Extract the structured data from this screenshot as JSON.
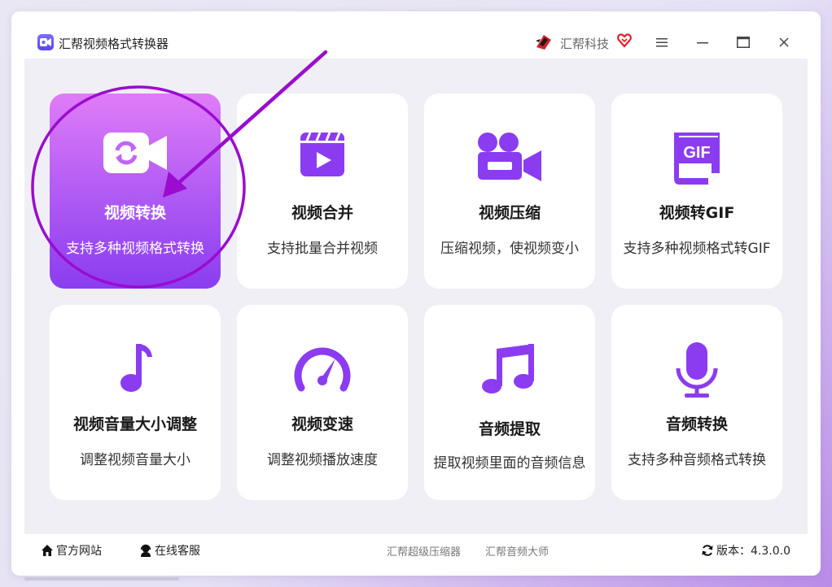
{
  "titlebar": {
    "app_title": "汇帮视频格式转换器",
    "brand_name": "汇帮科技",
    "controls": [
      "menu-icon",
      "minimize-icon",
      "maximize-icon",
      "close-icon"
    ]
  },
  "cards": [
    {
      "title": "视频转换",
      "desc": "支持多种视频格式转换",
      "icon": "video-convert-icon",
      "active": true
    },
    {
      "title": "视频合并",
      "desc": "支持批量合并视频",
      "icon": "clapper-play-icon"
    },
    {
      "title": "视频压缩",
      "desc": "压缩视频，使视频变小",
      "icon": "video-camera-icon"
    },
    {
      "title": "视频转GIF",
      "desc": "支持多种视频格式转GIF",
      "icon": "gif-file-icon",
      "icon_text": "GIF"
    },
    {
      "title": "视频音量大小调整",
      "desc": "调整视频音量大小",
      "icon": "music-note-icon"
    },
    {
      "title": "视频变速",
      "desc": "调整视频播放速度",
      "icon": "speedometer-icon"
    },
    {
      "title": "音频提取",
      "desc": "提取视频里面的音频信息",
      "icon": "music-notes-icon"
    },
    {
      "title": "音频转换",
      "desc": "支持多种音频格式转换",
      "icon": "microphone-icon"
    }
  ],
  "footer": {
    "website": "官方网站",
    "support": "在线客服",
    "link1": "汇帮超级压缩器",
    "link2": "汇帮音频大师",
    "version": "版本：4.3.0.0"
  },
  "colors": {
    "accent": "#8b3cf0",
    "active_card_top": "#e07cf8",
    "active_card_bottom": "#8a3df0",
    "annotation": "#9a0ccf",
    "background": "#f0eff5"
  }
}
